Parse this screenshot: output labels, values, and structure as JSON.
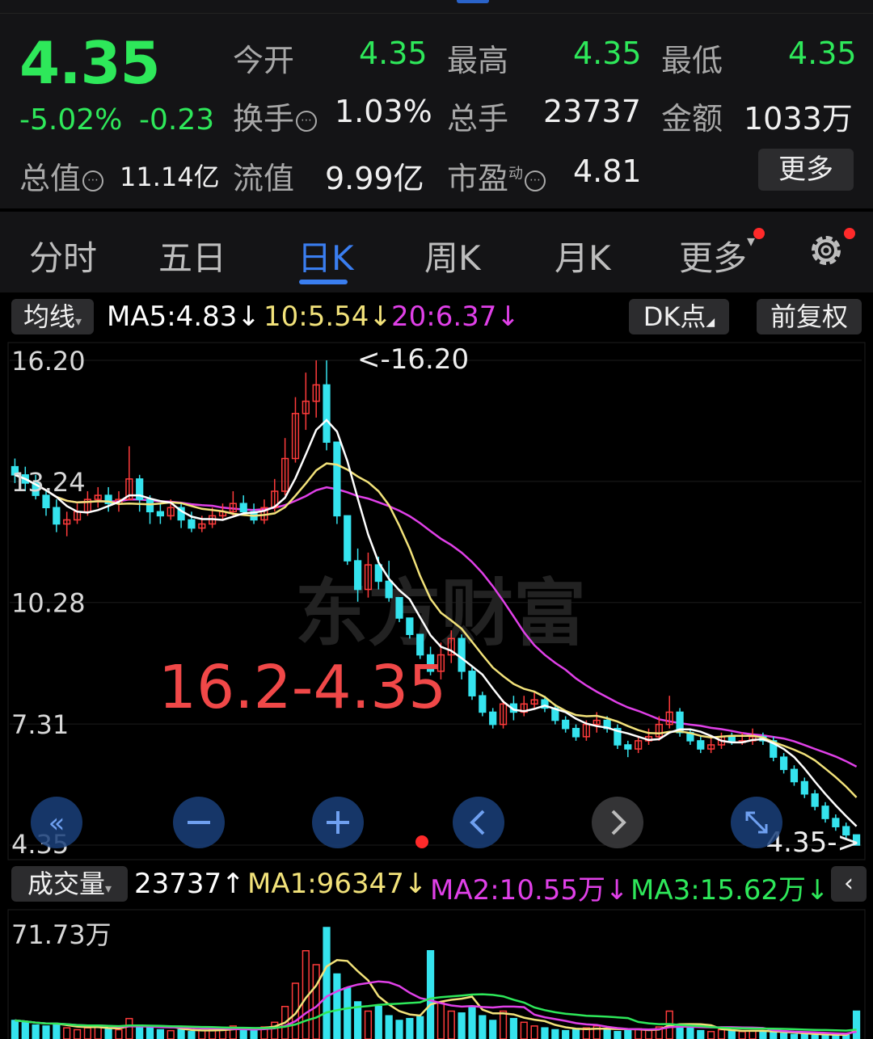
{
  "quote": {
    "price": "4.35",
    "change_pct": "-5.02%",
    "change_abs": "-0.23",
    "open_label": "今开",
    "open_value": "4.35",
    "high_label": "最高",
    "high_value": "4.35",
    "low_label": "最低",
    "low_value": "4.35",
    "turnover_label": "换手",
    "turnover_value": "1.03%",
    "total_hands_label": "总手",
    "total_hands_value": "23737",
    "amount_label": "金额",
    "amount_value": "1033万",
    "mktcap_label": "总值",
    "mktcap_value": "11.14亿",
    "float_label": "流值",
    "float_value": "9.99亿",
    "pe_label": "市盈",
    "pe_sup": "动",
    "pe_value": "4.81",
    "more_label": "更多"
  },
  "tabs": [
    "分时",
    "五日",
    "日K",
    "周K",
    "月K",
    "更多"
  ],
  "active_tab": "日K",
  "ma_bar": {
    "selector": "均线",
    "ma5": "MA5:4.83↓",
    "ma10": "10:5.54↓",
    "ma20": "20:6.37↓",
    "dk_label": "DK点",
    "adjust_label": "前复权"
  },
  "vol_bar": {
    "selector": "成交量",
    "vol": "23737↑",
    "ma1": "MA1:96347↓",
    "ma2": "MA2:10.55万↓",
    "ma3": "MA3:15.62万↓"
  },
  "colors": {
    "up": "#ff3b3b",
    "down": "#35e3ee",
    "ma5": "#ffffff",
    "ma10": "#f2e27a",
    "ma20": "#e040e8",
    "green": "#2ee85a",
    "accent": "#3a7ef0"
  },
  "icons": [
    "rewind-icon",
    "zoom-out-icon",
    "zoom-in-icon",
    "prev-icon",
    "next-icon",
    "fullscreen-icon",
    "settings-icon",
    "collapse-icon"
  ],
  "chart_data": {
    "type": "candlestick",
    "title": "",
    "overlay_text": "16.2-4.35",
    "y_ticks": [
      "16.20",
      "13.24",
      "10.28",
      "7.31",
      "4.35"
    ],
    "ylim": [
      4.35,
      16.2
    ],
    "high_marker": "<-16.20",
    "low_marker": "4.35->",
    "candles": [
      [
        13.6,
        13.4,
        13.8,
        13.2
      ],
      [
        13.4,
        13.2,
        13.6,
        13.0
      ],
      [
        13.2,
        12.9,
        13.4,
        12.8
      ],
      [
        12.9,
        12.6,
        13.0,
        12.4
      ],
      [
        12.6,
        12.2,
        12.8,
        12.0
      ],
      [
        12.2,
        12.3,
        12.5,
        11.9
      ],
      [
        12.3,
        12.5,
        12.7,
        12.2
      ],
      [
        12.5,
        12.8,
        13.0,
        12.4
      ],
      [
        12.8,
        12.9,
        13.1,
        12.6
      ],
      [
        12.9,
        12.7,
        13.1,
        12.5
      ],
      [
        12.7,
        12.8,
        13.0,
        12.5
      ],
      [
        12.8,
        13.3,
        14.1,
        12.8
      ],
      [
        13.3,
        12.8,
        13.4,
        12.5
      ],
      [
        12.8,
        12.5,
        12.9,
        12.2
      ],
      [
        12.5,
        12.4,
        12.7,
        12.2
      ],
      [
        12.4,
        12.6,
        12.8,
        12.3
      ],
      [
        12.6,
        12.3,
        12.7,
        12.1
      ],
      [
        12.3,
        12.1,
        12.5,
        12.0
      ],
      [
        12.1,
        12.2,
        12.4,
        12.0
      ],
      [
        12.2,
        12.4,
        12.6,
        12.1
      ],
      [
        12.4,
        12.5,
        12.7,
        12.3
      ],
      [
        12.5,
        12.7,
        13.0,
        12.4
      ],
      [
        12.7,
        12.5,
        12.9,
        12.4
      ],
      [
        12.5,
        12.3,
        12.7,
        12.2
      ],
      [
        12.3,
        12.6,
        12.8,
        12.2
      ],
      [
        12.6,
        13.0,
        13.3,
        12.5
      ],
      [
        13.0,
        13.8,
        14.3,
        12.9
      ],
      [
        13.8,
        14.9,
        15.3,
        13.7
      ],
      [
        14.9,
        15.2,
        15.9,
        14.5
      ],
      [
        15.2,
        15.6,
        16.2,
        14.8
      ],
      [
        15.6,
        14.2,
        16.2,
        14.0
      ],
      [
        14.2,
        12.4,
        14.2,
        12.2
      ],
      [
        12.4,
        11.3,
        12.4,
        11.2
      ],
      [
        11.3,
        10.6,
        11.6,
        10.3
      ],
      [
        10.6,
        11.2,
        11.5,
        10.4
      ],
      [
        11.2,
        10.8,
        11.4,
        10.6
      ],
      [
        10.8,
        10.4,
        11.3,
        10.3
      ],
      [
        10.4,
        9.9,
        10.4,
        9.8
      ],
      [
        9.9,
        9.5,
        9.9,
        9.4
      ],
      [
        9.5,
        9.0,
        9.5,
        8.9
      ],
      [
        9.0,
        8.6,
        9.2,
        8.5
      ],
      [
        8.6,
        9.0,
        9.3,
        8.4
      ],
      [
        9.0,
        9.4,
        9.6,
        8.8
      ],
      [
        9.4,
        8.6,
        9.5,
        8.4
      ],
      [
        8.6,
        8.0,
        8.7,
        7.9
      ],
      [
        8.0,
        7.6,
        8.1,
        7.5
      ],
      [
        7.6,
        7.3,
        7.7,
        7.2
      ],
      [
        7.3,
        7.8,
        7.9,
        7.2
      ],
      [
        7.8,
        7.6,
        8.0,
        7.4
      ],
      [
        7.6,
        7.8,
        8.0,
        7.5
      ],
      [
        7.8,
        7.9,
        8.1,
        7.7
      ],
      [
        7.9,
        7.7,
        8.0,
        7.6
      ],
      [
        7.7,
        7.4,
        7.8,
        7.3
      ],
      [
        7.4,
        7.2,
        7.5,
        7.1
      ],
      [
        7.2,
        7.0,
        7.3,
        6.9
      ],
      [
        7.0,
        7.3,
        7.4,
        6.9
      ],
      [
        7.3,
        7.4,
        7.6,
        7.1
      ],
      [
        7.4,
        7.2,
        7.5,
        7.1
      ],
      [
        7.2,
        6.8,
        7.3,
        6.7
      ],
      [
        6.8,
        6.7,
        6.9,
        6.5
      ],
      [
        6.7,
        6.9,
        7.0,
        6.6
      ],
      [
        6.9,
        7.0,
        7.2,
        6.8
      ],
      [
        7.0,
        7.3,
        7.5,
        6.9
      ],
      [
        7.3,
        7.6,
        8.0,
        7.2
      ],
      [
        7.6,
        7.1,
        7.7,
        7.0
      ],
      [
        7.1,
        6.9,
        7.2,
        6.8
      ],
      [
        6.9,
        6.7,
        7.0,
        6.6
      ],
      [
        6.7,
        6.8,
        7.0,
        6.6
      ],
      [
        6.8,
        7.0,
        7.1,
        6.7
      ],
      [
        7.0,
        6.9,
        7.1,
        6.8
      ],
      [
        6.9,
        6.9,
        7.1,
        6.8
      ],
      [
        6.9,
        7.0,
        7.2,
        6.8
      ],
      [
        7.0,
        6.9,
        7.1,
        6.8
      ],
      [
        6.9,
        6.5,
        7.0,
        6.4
      ],
      [
        6.5,
        6.2,
        6.6,
        6.1
      ],
      [
        6.2,
        5.9,
        6.3,
        5.8
      ],
      [
        5.9,
        5.6,
        6.0,
        5.5
      ],
      [
        5.6,
        5.3,
        5.7,
        5.2
      ],
      [
        5.3,
        5.0,
        5.4,
        4.9
      ],
      [
        5.0,
        4.8,
        5.1,
        4.7
      ],
      [
        4.8,
        4.6,
        4.9,
        4.5
      ],
      [
        4.6,
        4.35,
        4.6,
        4.35
      ]
    ],
    "volume_ylabel": "71.73万",
    "volumes": [
      20,
      18,
      15,
      14,
      16,
      12,
      10,
      12,
      14,
      11,
      10,
      22,
      15,
      12,
      10,
      9,
      10,
      8,
      9,
      10,
      11,
      14,
      12,
      10,
      13,
      18,
      35,
      60,
      95,
      80,
      120,
      70,
      55,
      40,
      30,
      35,
      25,
      20,
      22,
      24,
      95,
      40,
      30,
      28,
      35,
      25,
      20,
      30,
      22,
      18,
      14,
      12,
      10,
      9,
      10,
      12,
      14,
      10,
      8,
      9,
      11,
      10,
      13,
      30,
      15,
      12,
      9,
      8,
      10,
      9,
      8,
      9,
      8,
      7,
      6,
      5,
      5,
      4,
      5,
      4,
      4,
      30
    ],
    "volume_ymax": 120
  }
}
